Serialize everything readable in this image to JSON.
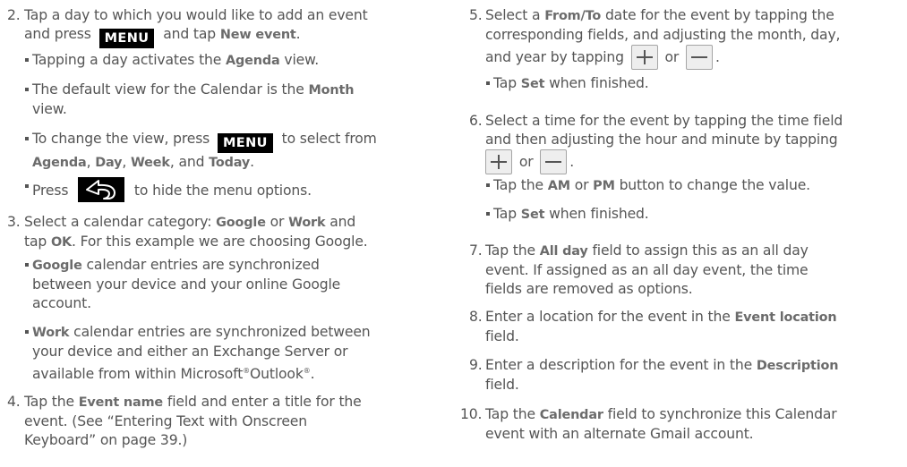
{
  "keys": {
    "menu": "MENU"
  },
  "left": {
    "s2": {
      "num": "2.",
      "l1": "Tap a day to which you would like to add an event",
      "l2a": "and press",
      "l2b": "and tap",
      "l2c": "New event",
      "l2d": "."
    },
    "b1": {
      "a": "Tapping a day activates the",
      "b": "Agenda",
      "c": "view."
    },
    "b2": {
      "a": "The default view for the Calendar is the",
      "b": "Month",
      "c": "view."
    },
    "b3": {
      "a": "To change the view, press",
      "b": "to select from",
      "c": "Agenda",
      "d": ",",
      "e": "Day",
      "f": ",",
      "g": "Week",
      "h": ", and",
      "i": "Today",
      "j": "."
    },
    "b4": {
      "a": "Press",
      "b": "to hide the menu options."
    },
    "s3": {
      "num": "3.",
      "a": "Select a calendar category:",
      "b": "Google",
      "c": "or",
      "d": "Work",
      "e": "and",
      "f": "tap",
      "g": "OK",
      "h": ". For this example we are choosing Google."
    },
    "b5": {
      "a": "Google",
      "b": "calendar entries are synchronized",
      "c": "between your device and your online Google",
      "d": "account."
    },
    "b6": {
      "a": "Work",
      "b": "calendar entries are synchronized between",
      "c": "your device and either an Exchange Server or",
      "d": "available from within Microsoft",
      "e": "®",
      "f": "Outlook",
      "g": "®",
      "h": "."
    },
    "s4": {
      "num": "4.",
      "a": "Tap the",
      "b": "Event name",
      "c": "field and enter a title for the",
      "d": "event. (See “Entering Text with Onscreen",
      "e": "Keyboard” on page 39.)"
    }
  },
  "right": {
    "s5": {
      "num": "5.",
      "a": "Select a",
      "b": "From/To",
      "c": "date for the event by tapping the",
      "d": "corresponding fields, and adjusting the month, day,",
      "e": "and year by tapping",
      "f": "or",
      "g": "."
    },
    "b1": {
      "a": "Tap",
      "b": "Set",
      "c": "when finished."
    },
    "s6": {
      "num": "6.",
      "a": "Select a time for the event by tapping the time field",
      "b": "and then adjusting the hour and minute by tapping",
      "c": "or",
      "d": "."
    },
    "b2": {
      "a": "Tap the",
      "b": "AM",
      "c": "or",
      "d": "PM",
      "e": "button to change the value."
    },
    "b3": {
      "a": "Tap",
      "b": "Set",
      "c": "when finished."
    },
    "s7": {
      "num": "7.",
      "a": "Tap the",
      "b": "All day",
      "c": "field to assign this as an all day",
      "d": "event. If assigned as an all day event, the time",
      "e": "fields are removed as options."
    },
    "s8": {
      "num": "8.",
      "a": "Enter a location for the event in the",
      "b": "Event location",
      "c": "field."
    },
    "s9": {
      "num": "9.",
      "a": "Enter a description for the event in the",
      "b": "Description",
      "c": "field."
    },
    "s10": {
      "num": "10.",
      "a": "Tap the",
      "b": "Calendar",
      "c": "field to synchronize this Calendar",
      "d": "event with an alternate Gmail account."
    }
  }
}
